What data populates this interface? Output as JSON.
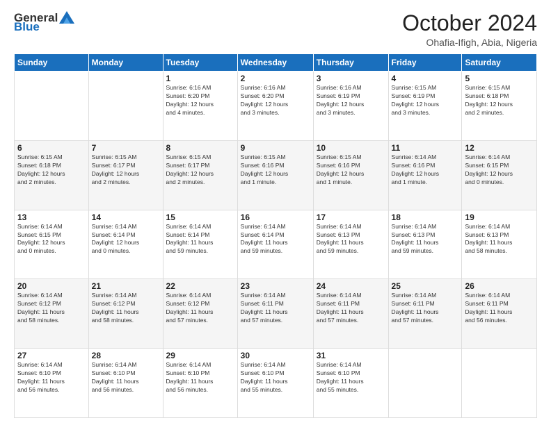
{
  "logo": {
    "general": "General",
    "blue": "Blue"
  },
  "title": "October 2024",
  "location": "Ohafia-Ifigh, Abia, Nigeria",
  "days_of_week": [
    "Sunday",
    "Monday",
    "Tuesday",
    "Wednesday",
    "Thursday",
    "Friday",
    "Saturday"
  ],
  "weeks": [
    [
      {
        "day": "",
        "info": ""
      },
      {
        "day": "",
        "info": ""
      },
      {
        "day": "1",
        "info": "Sunrise: 6:16 AM\nSunset: 6:20 PM\nDaylight: 12 hours\nand 4 minutes."
      },
      {
        "day": "2",
        "info": "Sunrise: 6:16 AM\nSunset: 6:20 PM\nDaylight: 12 hours\nand 3 minutes."
      },
      {
        "day": "3",
        "info": "Sunrise: 6:16 AM\nSunset: 6:19 PM\nDaylight: 12 hours\nand 3 minutes."
      },
      {
        "day": "4",
        "info": "Sunrise: 6:15 AM\nSunset: 6:19 PM\nDaylight: 12 hours\nand 3 minutes."
      },
      {
        "day": "5",
        "info": "Sunrise: 6:15 AM\nSunset: 6:18 PM\nDaylight: 12 hours\nand 2 minutes."
      }
    ],
    [
      {
        "day": "6",
        "info": "Sunrise: 6:15 AM\nSunset: 6:18 PM\nDaylight: 12 hours\nand 2 minutes."
      },
      {
        "day": "7",
        "info": "Sunrise: 6:15 AM\nSunset: 6:17 PM\nDaylight: 12 hours\nand 2 minutes."
      },
      {
        "day": "8",
        "info": "Sunrise: 6:15 AM\nSunset: 6:17 PM\nDaylight: 12 hours\nand 2 minutes."
      },
      {
        "day": "9",
        "info": "Sunrise: 6:15 AM\nSunset: 6:16 PM\nDaylight: 12 hours\nand 1 minute."
      },
      {
        "day": "10",
        "info": "Sunrise: 6:15 AM\nSunset: 6:16 PM\nDaylight: 12 hours\nand 1 minute."
      },
      {
        "day": "11",
        "info": "Sunrise: 6:14 AM\nSunset: 6:16 PM\nDaylight: 12 hours\nand 1 minute."
      },
      {
        "day": "12",
        "info": "Sunrise: 6:14 AM\nSunset: 6:15 PM\nDaylight: 12 hours\nand 0 minutes."
      }
    ],
    [
      {
        "day": "13",
        "info": "Sunrise: 6:14 AM\nSunset: 6:15 PM\nDaylight: 12 hours\nand 0 minutes."
      },
      {
        "day": "14",
        "info": "Sunrise: 6:14 AM\nSunset: 6:14 PM\nDaylight: 12 hours\nand 0 minutes."
      },
      {
        "day": "15",
        "info": "Sunrise: 6:14 AM\nSunset: 6:14 PM\nDaylight: 11 hours\nand 59 minutes."
      },
      {
        "day": "16",
        "info": "Sunrise: 6:14 AM\nSunset: 6:14 PM\nDaylight: 11 hours\nand 59 minutes."
      },
      {
        "day": "17",
        "info": "Sunrise: 6:14 AM\nSunset: 6:13 PM\nDaylight: 11 hours\nand 59 minutes."
      },
      {
        "day": "18",
        "info": "Sunrise: 6:14 AM\nSunset: 6:13 PM\nDaylight: 11 hours\nand 59 minutes."
      },
      {
        "day": "19",
        "info": "Sunrise: 6:14 AM\nSunset: 6:13 PM\nDaylight: 11 hours\nand 58 minutes."
      }
    ],
    [
      {
        "day": "20",
        "info": "Sunrise: 6:14 AM\nSunset: 6:12 PM\nDaylight: 11 hours\nand 58 minutes."
      },
      {
        "day": "21",
        "info": "Sunrise: 6:14 AM\nSunset: 6:12 PM\nDaylight: 11 hours\nand 58 minutes."
      },
      {
        "day": "22",
        "info": "Sunrise: 6:14 AM\nSunset: 6:12 PM\nDaylight: 11 hours\nand 57 minutes."
      },
      {
        "day": "23",
        "info": "Sunrise: 6:14 AM\nSunset: 6:11 PM\nDaylight: 11 hours\nand 57 minutes."
      },
      {
        "day": "24",
        "info": "Sunrise: 6:14 AM\nSunset: 6:11 PM\nDaylight: 11 hours\nand 57 minutes."
      },
      {
        "day": "25",
        "info": "Sunrise: 6:14 AM\nSunset: 6:11 PM\nDaylight: 11 hours\nand 57 minutes."
      },
      {
        "day": "26",
        "info": "Sunrise: 6:14 AM\nSunset: 6:11 PM\nDaylight: 11 hours\nand 56 minutes."
      }
    ],
    [
      {
        "day": "27",
        "info": "Sunrise: 6:14 AM\nSunset: 6:10 PM\nDaylight: 11 hours\nand 56 minutes."
      },
      {
        "day": "28",
        "info": "Sunrise: 6:14 AM\nSunset: 6:10 PM\nDaylight: 11 hours\nand 56 minutes."
      },
      {
        "day": "29",
        "info": "Sunrise: 6:14 AM\nSunset: 6:10 PM\nDaylight: 11 hours\nand 56 minutes."
      },
      {
        "day": "30",
        "info": "Sunrise: 6:14 AM\nSunset: 6:10 PM\nDaylight: 11 hours\nand 55 minutes."
      },
      {
        "day": "31",
        "info": "Sunrise: 6:14 AM\nSunset: 6:10 PM\nDaylight: 11 hours\nand 55 minutes."
      },
      {
        "day": "",
        "info": ""
      },
      {
        "day": "",
        "info": ""
      }
    ]
  ]
}
